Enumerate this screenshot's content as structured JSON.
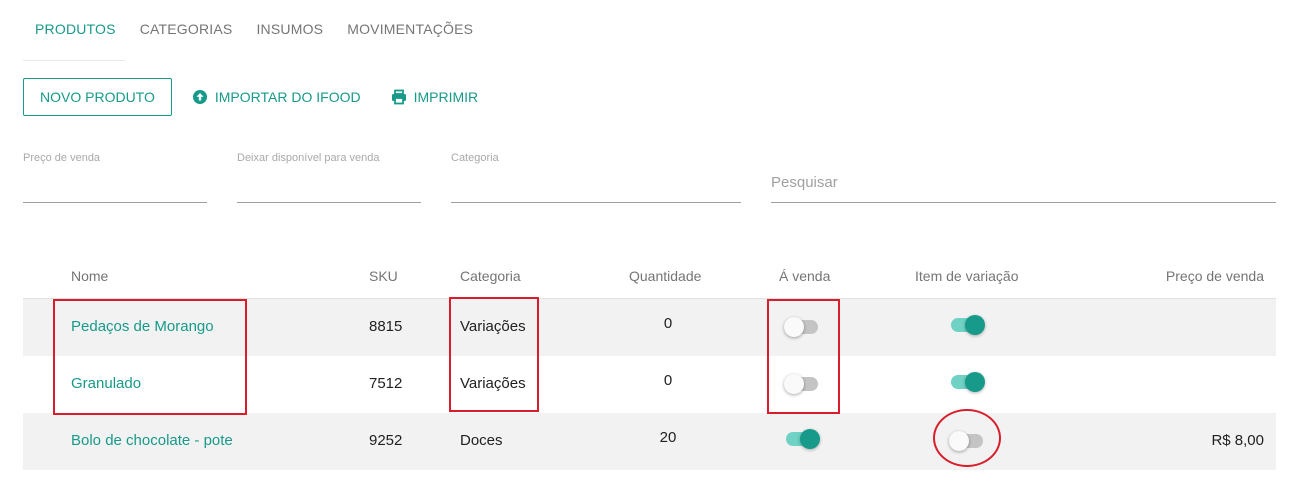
{
  "tabs": [
    {
      "label": "PRODUTOS",
      "active": true
    },
    {
      "label": "CATEGORIAS",
      "active": false
    },
    {
      "label": "INSUMOS",
      "active": false
    },
    {
      "label": "MOVIMENTAÇÕES",
      "active": false
    }
  ],
  "toolbar": {
    "new_product_label": "NOVO PRODUTO",
    "import_label": "IMPORTAR DO IFOOD",
    "import_icon": "upload-circle-icon",
    "print_label": "IMPRIMIR",
    "print_icon": "printer-icon"
  },
  "filters": {
    "price_label": "Preço de venda",
    "available_label": "Deixar disponível para venda",
    "category_label": "Categoria",
    "search_placeholder": "Pesquisar"
  },
  "table": {
    "headers": {
      "name": "Nome",
      "sku": "SKU",
      "category": "Categoria",
      "quantity": "Quantidade",
      "for_sale": "Á venda",
      "variation_item": "Item de variação",
      "price": "Preço de venda"
    },
    "rows": [
      {
        "name": "Pedaços de Morango",
        "sku": "8815",
        "category": "Variações",
        "quantity": "0",
        "for_sale": false,
        "variation_item": true,
        "price": ""
      },
      {
        "name": "Granulado",
        "sku": "7512",
        "category": "Variações",
        "quantity": "0",
        "for_sale": false,
        "variation_item": true,
        "price": ""
      },
      {
        "name": "Bolo de chocolate - pote",
        "sku": "9252",
        "category": "Doces",
        "quantity": "20",
        "for_sale": true,
        "variation_item": false,
        "price": "R$ 8,00"
      }
    ]
  },
  "colors": {
    "accent": "#179a8a",
    "toggle_on_track": "#6fd2c4",
    "annotation": "#d81e2a",
    "row_shade": "#f2f2f2"
  }
}
